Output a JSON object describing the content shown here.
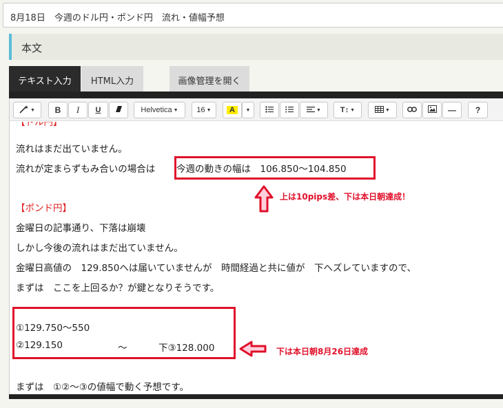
{
  "title_field": {
    "value": "8月18日　今週のドル円・ポンド円　流れ・値幅予想"
  },
  "section": {
    "label": "本文"
  },
  "tabs": [
    {
      "label": "テキスト入力",
      "active": true
    },
    {
      "label": "HTML入力"
    },
    {
      "label": "画像管理を開く"
    }
  ],
  "toolbar": {
    "magic": "magic-wand-icon",
    "bold": "B",
    "italic": "I",
    "underline": "U",
    "eraser": "eraser-icon",
    "font": "Helvetica",
    "size": "16",
    "color": "A",
    "ul": "unordered-list-icon",
    "ol": "ordered-list-icon",
    "align": "align-icon",
    "lineheight": "T↕",
    "table": "table-icon",
    "link": "link-icon",
    "picture": "picture-icon",
    "hr": "—",
    "help": "?"
  },
  "body_lines": {
    "l0": "【ドル円】",
    "l1": "流れはまだ出ていません。",
    "l2a": "流れが定まらずもみ合いの場合は",
    "l2b": "今週の動きの幅は　106.850～104.850",
    "l3": "【ポンド円】",
    "l4": "金曜日の記事通り、下落は崩壊",
    "l5": "しかし今後の流れはまだ出ていません。",
    "l6": "金曜日高値の　129.850へは届いていませんが　時間経過と共に値が　下へズレていますので、",
    "l7": "まずは　ここを上回るか？が鍵となりそうです。",
    "l8": "①129.750～550",
    "l9a": "②129.150",
    "l9b": "～",
    "l9c": "下③128.000",
    "l10": "まずは　①②～③の値幅で動く予想です。"
  },
  "annotations": {
    "note1": "上は10pips差、下は本日朝達成！",
    "note2": "下は本日朝8月26日達成"
  },
  "colors": {
    "accent_red": "#e0102a",
    "tab_active": "#2b2b2b",
    "section_border": "#5bbcd8"
  }
}
